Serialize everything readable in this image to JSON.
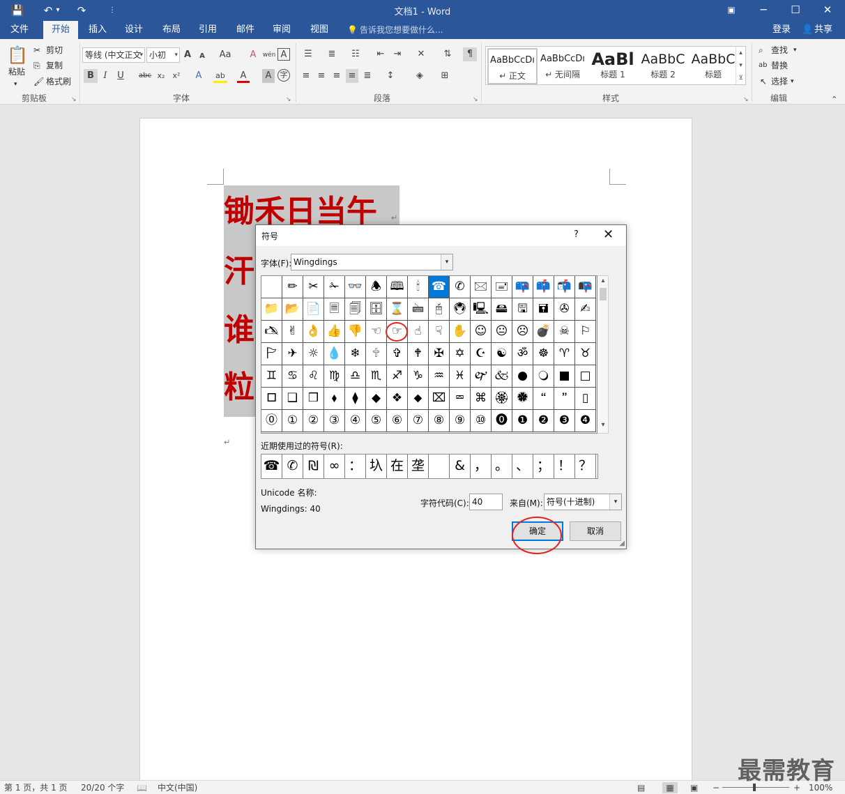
{
  "titlebar": {
    "title": "文档1 - Word",
    "save_icon": "💾",
    "undo_icon": "↶",
    "undo_drop": "▾",
    "redo_icon": "↷",
    "customize_icon": "⫶",
    "ribbon_display_icon": "▣",
    "minimize_icon": "─",
    "maximize_icon": "☐",
    "close_icon": "✕"
  },
  "tabs": [
    "文件",
    "开始",
    "插入",
    "设计",
    "布局",
    "引用",
    "邮件",
    "审阅",
    "视图"
  ],
  "tell_me": "告诉我您想要做什么...",
  "signin": "登录",
  "share": "共享",
  "ribbon": {
    "clipboard": {
      "paste": "粘贴",
      "cut": "剪切",
      "copy": "复制",
      "format_painter": "格式刷",
      "label": "剪贴板"
    },
    "font": {
      "font_name": "等线 (中文正文",
      "font_size": "小初",
      "grow": "A",
      "shrink": "A",
      "case": "Aa",
      "clear": "A",
      "phonetic": "wén",
      "border_char": "A",
      "bold": "B",
      "italic": "I",
      "underline": "U",
      "strike": "abc",
      "sub": "x₂",
      "sup": "x²",
      "effects": "A",
      "highlight": "ab",
      "color": "A",
      "shade": "A",
      "enclose": "字",
      "label": "字体"
    },
    "paragraph": {
      "label": "段落"
    },
    "styles": {
      "items": [
        {
          "sample": "AaBbCcDı",
          "name": "↵ 正文"
        },
        {
          "sample": "AaBbCcDı",
          "name": "↵ 无间隔"
        },
        {
          "sample": "AaBl",
          "name": "标题 1"
        },
        {
          "sample": "AaBbC",
          "name": "标题 2"
        },
        {
          "sample": "AaBbC",
          "name": "标题"
        }
      ],
      "label": "样式"
    },
    "editing": {
      "find": "查找",
      "replace": "替换",
      "select": "选择",
      "label": "编辑"
    }
  },
  "document": {
    "lines": [
      "锄禾日当午",
      "汗",
      "谁",
      "粒"
    ],
    "paragraph_mark": "↵"
  },
  "dialog": {
    "title": "符号",
    "help": "?",
    "close": "✕",
    "font_label": "字体(F):",
    "font_value": "Wingdings",
    "dropdown_arrow": "▾",
    "symbols": [
      " ",
      "✏",
      "✂",
      "✁",
      "👓",
      "🕭",
      "🕮",
      "🕯",
      "☎",
      "✆",
      "🖂",
      "🖃",
      "📪",
      "📫",
      "📬",
      "📭",
      "📁",
      "📂",
      "📄",
      "🗏",
      "🗐",
      "🗄",
      "⌛",
      "🖮",
      "🖰",
      "🖲",
      "🖳",
      "🖴",
      "🖫",
      "🖬",
      "✇",
      "✍",
      "🖎",
      "✌",
      "👌",
      "👍",
      "👎",
      "☜",
      "☞",
      "☝",
      "☟",
      "✋",
      "☺",
      "😐",
      "☹",
      "💣",
      "☠",
      "⚐",
      "🏱",
      "✈",
      "☼",
      "💧",
      "❄",
      "🕆",
      "✞",
      "🕈",
      "✠",
      "✡",
      "☪",
      "☯",
      "ॐ",
      "☸",
      "♈",
      "♉",
      "♊",
      "♋",
      "♌",
      "♍",
      "♎",
      "♏",
      "♐",
      "♑",
      "♒",
      "♓",
      "🙰",
      "🙵",
      "●",
      "🔾",
      "■",
      "□",
      "🞐",
      "❑",
      "❒",
      "⬧",
      "⧫",
      "◆",
      "❖",
      "⬥",
      "⌧",
      "⮹",
      "⌘",
      "🏵",
      "🏶",
      "🙶",
      "🙷",
      "▯",
      "⓪",
      "①",
      "②",
      "③",
      "④",
      "⑤",
      "⑥",
      "⑦",
      "⑧",
      "⑨",
      "⑩",
      "⓿",
      "❶",
      "❷",
      "❸",
      "❹"
    ],
    "selected_index": 8,
    "recent_label": "近期使用过的符号(R):",
    "recent_symbols": [
      "☎",
      "✆",
      "₪",
      "∞",
      "：",
      "圦",
      "在",
      "垄",
      " ",
      "&",
      "，",
      "。",
      "、",
      "；",
      "！",
      "？"
    ],
    "unicode_name_label": "Unicode 名称:",
    "unicode_name_value": "Wingdings: 40",
    "charcode_label": "字符代码(C):",
    "charcode_value": "40",
    "from_label": "来自(M):",
    "from_value": "符号(十进制)",
    "ok": "确定",
    "cancel": "取消"
  },
  "statusbar": {
    "page": "第 1 页，共 1 页",
    "words": "20/20 个字",
    "proof_icon": "📖",
    "language": "中文(中国)",
    "zoom_minus": "−",
    "zoom_plus": "+",
    "zoom": "100%"
  },
  "watermark": "最需教育"
}
